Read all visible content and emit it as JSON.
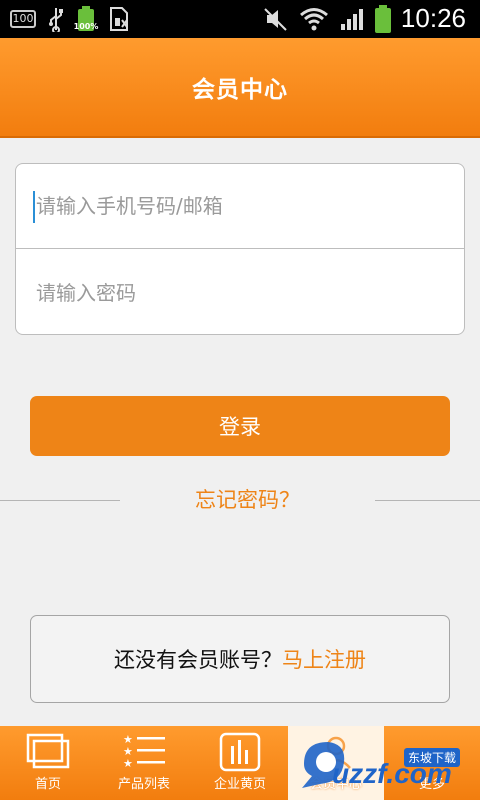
{
  "status_bar": {
    "indicator_box": "100",
    "battery_small_pct": "100%",
    "time": "10:26",
    "colors": {
      "battery": "#6abf3b"
    }
  },
  "header": {
    "title": "会员中心"
  },
  "login": {
    "account_placeholder": "请输入手机号码/邮箱",
    "password_placeholder": "请输入密码",
    "login_button": "登录",
    "forgot_password": "忘记密码？"
  },
  "register": {
    "prompt": "还没有会员账号？",
    "link": "马上注册"
  },
  "bottom_nav": {
    "items": [
      {
        "label": "首页",
        "icon": "home-windows-icon"
      },
      {
        "label": "产品列表",
        "icon": "list-star-icon"
      },
      {
        "label": "企业黄页",
        "icon": "bar-chart-icon"
      },
      {
        "label": "会员中心",
        "icon": "member-icon",
        "active": true
      },
      {
        "label": "更多",
        "icon": "more-icon"
      }
    ]
  },
  "watermark": {
    "site": "uzzf.com",
    "badge": "东坡下载"
  },
  "colors": {
    "accent": "#ee8417",
    "header_top": "#ff9b2e",
    "header_bottom": "#f27d0e"
  }
}
